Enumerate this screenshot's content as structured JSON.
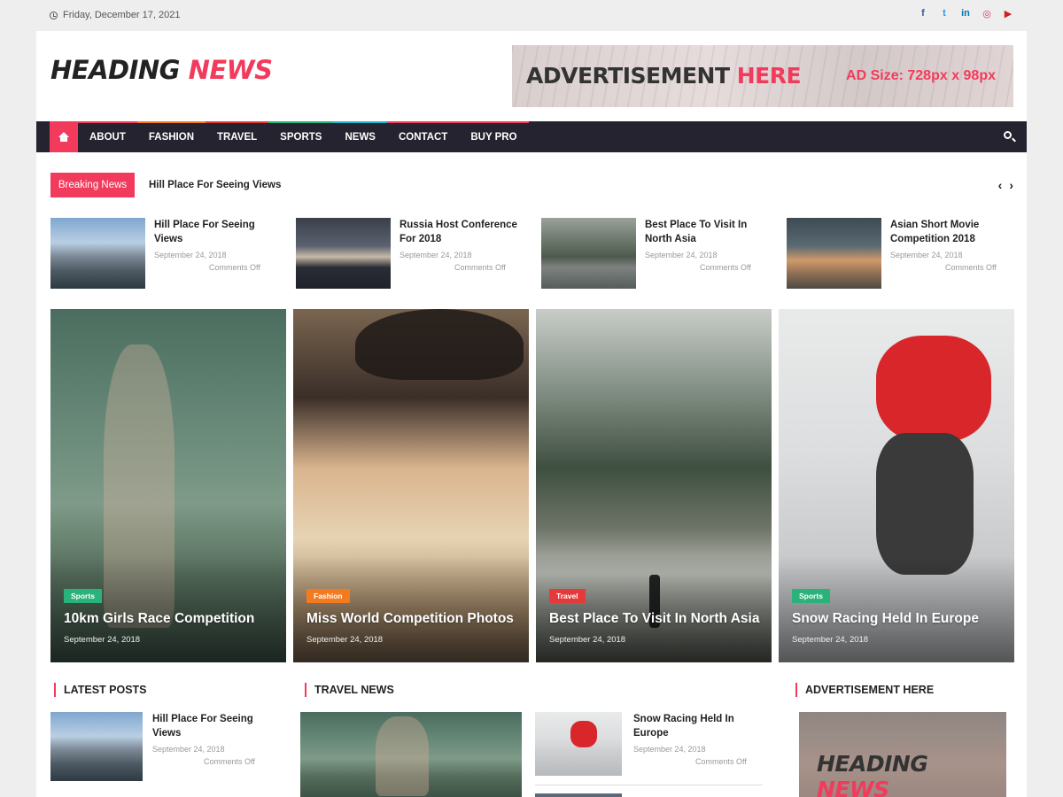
{
  "topbar": {
    "date": "Friday, December 17, 2021",
    "social": [
      {
        "icon": "facebook-icon",
        "glyph": "f",
        "color": "#3b5998"
      },
      {
        "icon": "twitter-icon",
        "glyph": "t",
        "color": "#1da1f2"
      },
      {
        "icon": "linkedin-icon",
        "glyph": "in",
        "color": "#0077b5"
      },
      {
        "icon": "instagram-icon",
        "glyph": "◎",
        "color": "#e1306c"
      },
      {
        "icon": "youtube-icon",
        "glyph": "▶",
        "color": "#cd201f"
      }
    ]
  },
  "header": {
    "logo_main": "HEADING",
    "logo_accent": "NEWS",
    "ad_title_main": "ADVERTISEMENT",
    "ad_title_accent": "HERE",
    "ad_size": "AD Size: 728px x 98px"
  },
  "nav": {
    "items": [
      {
        "label": "ABOUT",
        "color": "#f23b5c"
      },
      {
        "label": "FASHION",
        "color": "#f47a20"
      },
      {
        "label": "TRAVEL",
        "color": "#e53a3a"
      },
      {
        "label": "SPORTS",
        "color": "#2ab27b"
      },
      {
        "label": "NEWS",
        "color": "#1fb6c9"
      },
      {
        "label": "CONTACT",
        "color": "#f23b5c"
      },
      {
        "label": "BUY PRO",
        "color": "#f23b5c"
      }
    ]
  },
  "breaking": {
    "label": "Breaking News",
    "headline": "Hill Place For Seeing Views",
    "prev": "‹",
    "next": "›"
  },
  "thumbs": [
    {
      "title": "Hill Place For Seeing Views",
      "date": "September 24, 2018",
      "comments": "Comments Off",
      "photo": "ph-mountain"
    },
    {
      "title": "Russia Host Conference For 2018",
      "date": "September 24, 2018",
      "comments": "Comments Off",
      "photo": "ph-crowd"
    },
    {
      "title": "Best Place To Visit In North Asia",
      "date": "September 24, 2018",
      "comments": "Comments Off",
      "photo": "ph-river"
    },
    {
      "title": "Asian Short Movie Competition 2018",
      "date": "September 24, 2018",
      "comments": "Comments Off",
      "photo": "ph-camera"
    }
  ],
  "featured": [
    {
      "category": "Sports",
      "cat_color": "#2ab27b",
      "title": "10km Girls Race Competition",
      "date": "September 24, 2018",
      "photo": "ph-runner"
    },
    {
      "category": "Fashion",
      "cat_color": "#f47a20",
      "title": "Miss World Competition Photos",
      "date": "September 24, 2018",
      "photo": "ph-hat"
    },
    {
      "category": "Travel",
      "cat_color": "#e53a3a",
      "title": "Best Place To Visit In North Asia",
      "date": "September 24, 2018",
      "photo": "ph-forest"
    },
    {
      "category": "Sports",
      "cat_color": "#2ab27b",
      "title": "Snow Racing Held In Europe",
      "date": "September 24, 2018",
      "photo": "ph-ski"
    }
  ],
  "sections": {
    "latest": "LATEST POSTS",
    "travel": "TRAVEL NEWS",
    "ad": "ADVERTISEMENT HERE"
  },
  "latest_posts": [
    {
      "title": "Hill Place For Seeing Views",
      "date": "September 24, 2018",
      "comments": "Comments Off"
    }
  ],
  "travel_news": [
    {
      "title": "Snow Racing Held In Europe",
      "date": "September 24, 2018",
      "comments": "Comments Off"
    }
  ],
  "side_ad": {
    "logo_main": "HEADING",
    "logo_accent": "NEWS"
  }
}
